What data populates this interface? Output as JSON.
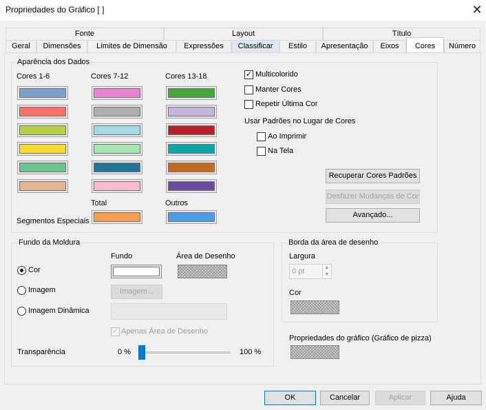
{
  "window": {
    "title": "Propriedades do Gráfico [ ]",
    "close_glyph": "✕"
  },
  "tabs": {
    "upper": [
      "Fonte",
      "Layout",
      "Título"
    ],
    "lower": [
      "Geral",
      "Dimensões",
      "Limites de Dimensão",
      "Expressões",
      "Classificar",
      "Estilo",
      "Apresentação",
      "Eixos",
      "Cores",
      "Número"
    ],
    "selected": "Cores",
    "highlighted": "Classificar"
  },
  "data_appearance": {
    "title": "Aparência dos Dados",
    "col1_label": "Cores 1-6",
    "col2_label": "Cores 7-12",
    "col3_label": "Cores 13-18",
    "colors_1_6": [
      "#7ea1c9",
      "#fd7067",
      "#b5d149",
      "#fedb2f",
      "#6bc392",
      "#e3b692"
    ],
    "colors_7_12": [
      "#e983d3",
      "#aeaeae",
      "#a5d9e9",
      "#a8e6b6",
      "#217696",
      "#f8bccd"
    ],
    "colors_13_18": [
      "#45a73b",
      "#c6b3e0",
      "#b7232b",
      "#07a6a9",
      "#c36b23",
      "#6a4c9c"
    ],
    "total_label": "Total",
    "others_label": "Outros",
    "special_label": "Segmentos Especiais",
    "total_color": "#f59f4e",
    "others_color": "#4a9be8",
    "multicolor_label": "Multicolorido",
    "multicolor_checked": true,
    "keep_colors_label": "Manter Cores",
    "repeat_last_label": "Repetir Última Cor",
    "patterns_label": "Usar Padrões no Lugar de Cores",
    "on_print_label": "Ao Imprimir",
    "on_screen_label": "Na Tela",
    "restore_defaults_btn": "Recuperar Cores Padrões",
    "undo_changes_btn": "Desfazer Mudanças de Cor",
    "advanced_btn": "Avançado..."
  },
  "frame_bg": {
    "title": "Fundo da Moldura",
    "col_fundo": "Fundo",
    "col_area": "Área de Desenho",
    "opt_color": "Cor",
    "opt_image": "Imagem",
    "opt_dynamic": "Imagem Dinâmica",
    "image_btn": "Imagem...",
    "only_area_label": "Apenas Área de Desenho",
    "transparency_label": "Transparência",
    "min_label": "0 %",
    "max_label": "100 %",
    "transparency_value": 0
  },
  "plot_border": {
    "title": "Borda da área de desenho",
    "width_label": "Largura",
    "width_value": "0 pt",
    "color_label": "Cor"
  },
  "chart_props_label": "Propriedades do gráfico (Gráfico de pizza)",
  "footer": {
    "ok": "OK",
    "cancel": "Cancelar",
    "apply": "Aplicar",
    "help": "Ajuda"
  }
}
